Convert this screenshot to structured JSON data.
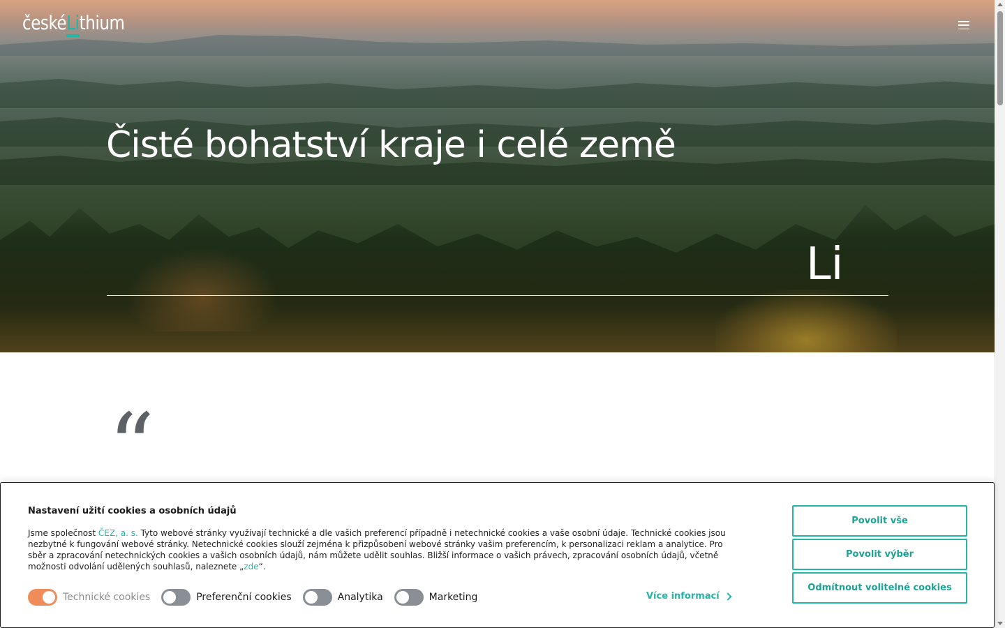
{
  "header": {
    "logo_part1": "české",
    "logo_accent": "Li",
    "logo_part2": "thium",
    "menu_icon": "hamburger-icon"
  },
  "hero": {
    "title": "Čisté bohatství kraje i celé země",
    "symbol": "Li"
  },
  "quote": {
    "mark": "“"
  },
  "cookie_panel": {
    "title": "Nastavení užití cookies a osobních údajů",
    "text_before_link": "Jsme společnost ",
    "company_link": "ČEZ, a. s.",
    "text_main": " Tyto webové stránky využívají technické a dle vašich preferencí případně i netechnické cookies a vaše osobní údaje. Technické cookies jsou nezbytné k fungování webové stránky. Netechnické cookies slouží zejména k přizpůsobení webové stránky vašim preferencím, k personalizaci reklam a analytice. Pro sběr a zpracování netechnických cookies a vašich osobních údajů, nám můžete udělit souhlas. Bližší informace o vašich právech, zpracování osobních údajů, včetně možnosti odvolání udělených souhlasů, naleznete „",
    "here_link": "zde",
    "text_end": "“.",
    "toggles": [
      {
        "label": "Technické cookies",
        "state": "on"
      },
      {
        "label": "Preferenční cookies",
        "state": "off"
      },
      {
        "label": "Analytika",
        "state": "off"
      },
      {
        "label": "Marketing",
        "state": "off"
      }
    ],
    "more_info": "Více informací",
    "buttons": {
      "allow_all": "Povolit vše",
      "allow_selection": "Povolit výběr",
      "reject_optional": "Odmítnout volitelné cookies"
    }
  },
  "colors": {
    "accent": "#22b5a8",
    "toggle_on": "#f08c5a",
    "toggle_off": "#8a8f95"
  }
}
